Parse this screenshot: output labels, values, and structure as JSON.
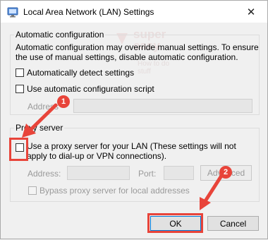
{
  "window": {
    "title": "Local Area Network (LAN) Settings",
    "close_glyph": "✕"
  },
  "watermark": {
    "line1": "super",
    "line2": "easy",
    "sub": "How to do stuff"
  },
  "auto_config": {
    "legend": "Automatic configuration",
    "description": "Automatic configuration may override manual settings. To ensure the use of manual settings, disable automatic configuration.",
    "detect_label": "Automatically detect settings",
    "script_label": "Use automatic configuration script",
    "address_label": "Address"
  },
  "proxy": {
    "legend": "Proxy server",
    "use_proxy_label": "Use a proxy server for your LAN (These settings will not apply to dial-up or VPN connections).",
    "address_label": "Address:",
    "port_label": "Port:",
    "advanced_label": "Advanced",
    "bypass_label": "Bypass proxy server for local addresses"
  },
  "buttons": {
    "ok": "OK",
    "cancel": "Cancel"
  },
  "annotations": {
    "badge1": "1",
    "badge2": "2",
    "color": "#e8443a"
  }
}
